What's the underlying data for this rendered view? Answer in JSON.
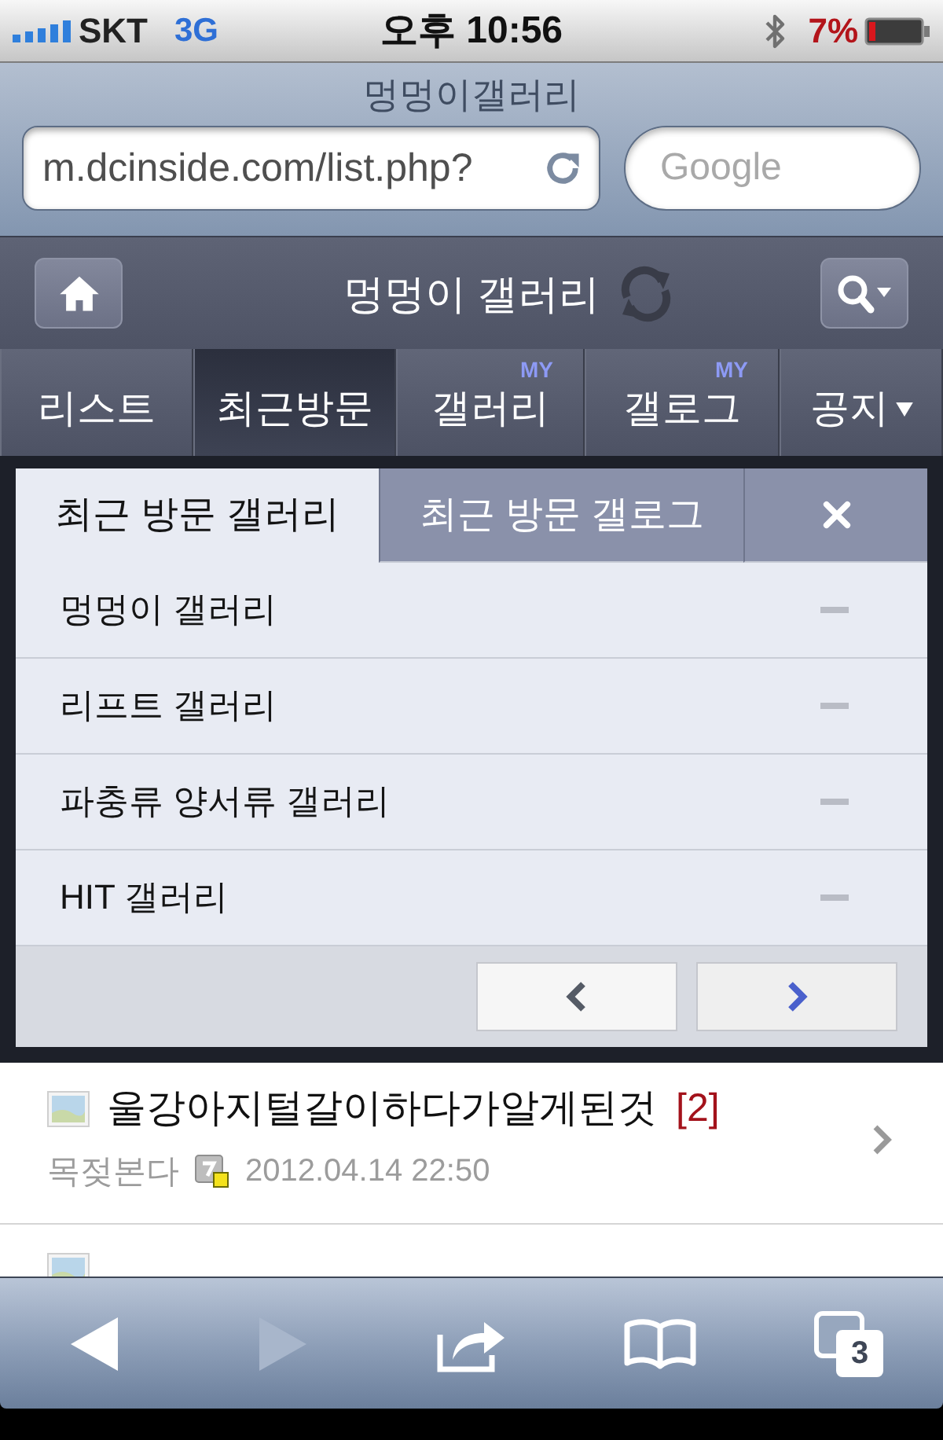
{
  "status_bar": {
    "carrier": "SKT",
    "network": "3G",
    "time": "오후 10:56",
    "battery": "7%"
  },
  "browser": {
    "page_title": "멍멍이갤러리",
    "url": "m.dcinside.com/list.php?",
    "search_placeholder": "Google"
  },
  "header": {
    "title": "멍멍이 갤러리"
  },
  "tabs": [
    {
      "label": "리스트",
      "selected": false,
      "dropdown": false
    },
    {
      "label": "최근방문",
      "selected": true,
      "dropdown": false
    },
    {
      "label": "갤러리",
      "badge": "MY",
      "selected": false,
      "dropdown": false
    },
    {
      "label": "갤로그",
      "badge": "MY",
      "selected": false,
      "dropdown": false
    },
    {
      "label": "공지",
      "selected": false,
      "dropdown": true
    }
  ],
  "recent_panel": {
    "tabs": [
      {
        "label": "최근 방문 갤러리",
        "selected": true
      },
      {
        "label": "최근 방문 갤로그",
        "selected": false
      }
    ],
    "items": [
      "멍멍이 갤러리",
      "리프트 갤러리",
      "파충류 양서류 갤러리",
      "HIT 갤러리"
    ],
    "pager": [
      {
        "kind": "prev",
        "disabled": true
      },
      {
        "kind": "next",
        "disabled": false
      }
    ]
  },
  "posts": [
    {
      "thumbnail": true,
      "title": "울강아지털갈이하다가알게된것",
      "comments": "[2]",
      "author": "목젖본다",
      "date": "2012.04.14 22:50"
    },
    {
      "thumbnail": true
    }
  ],
  "toolbar": [
    {
      "kind": "back",
      "disabled": false
    },
    {
      "kind": "forward",
      "disabled": true
    },
    {
      "kind": "share",
      "disabled": false
    },
    {
      "kind": "bookmarks",
      "disabled": false
    },
    {
      "kind": "tabs",
      "count": "3",
      "disabled": false
    }
  ]
}
